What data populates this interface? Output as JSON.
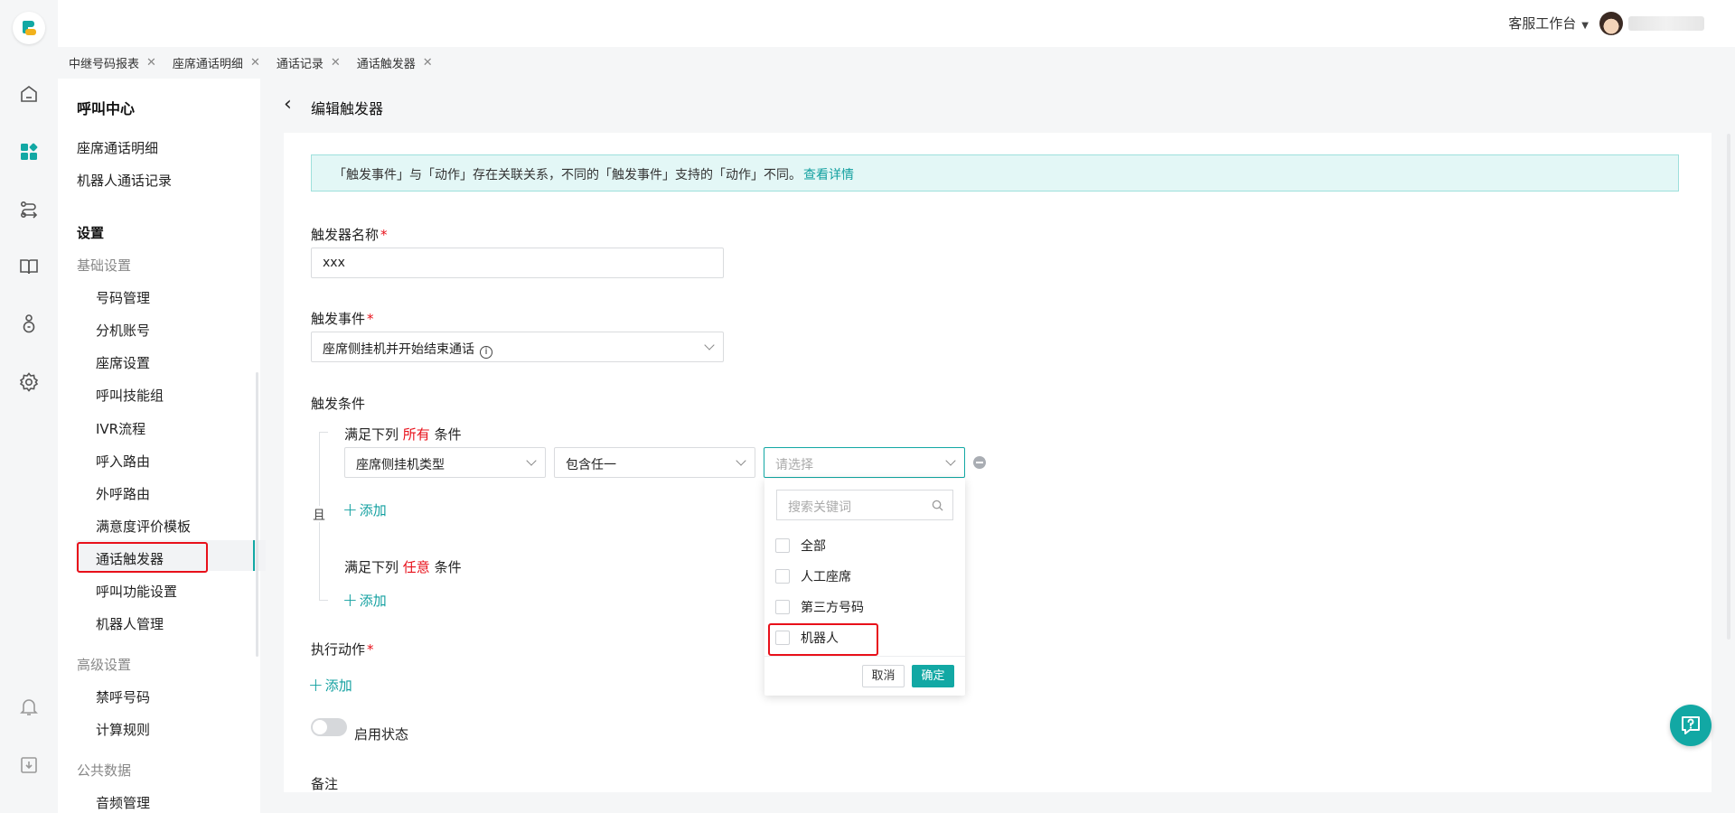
{
  "topbar": {
    "workspace_label": "客服工作台"
  },
  "tabs": [
    {
      "label": "中继号码报表"
    },
    {
      "label": "座席通话明细"
    },
    {
      "label": "通话记录"
    },
    {
      "label": "通话触发器"
    }
  ],
  "sidebar": {
    "title": "呼叫中心",
    "top_items": [
      "座席通话明细",
      "机器人通话记录"
    ],
    "settings_title": "设置",
    "groups": {
      "basic": "基础设置",
      "advanced": "高级设置",
      "public": "公共数据"
    },
    "basic_items": [
      "号码管理",
      "分机账号",
      "座席设置",
      "呼叫技能组",
      "IVR流程",
      "呼入路由",
      "外呼路由",
      "满意度评价模板",
      "通话触发器",
      "呼叫功能设置",
      "机器人管理"
    ],
    "advanced_items": [
      "禁呼号码",
      "计算规则"
    ],
    "public_items": [
      "音频管理"
    ],
    "active_item": "通话触发器"
  },
  "page": {
    "title": "编辑触发器",
    "notice_text": "「触发事件」与「动作」存在关联关系，不同的「触发事件」支持的「动作」不同。",
    "notice_link": "查看详情"
  },
  "form": {
    "name_label": "触发器名称",
    "name_value": "xxx",
    "event_label": "触发事件",
    "event_value": "座席侧挂机并开始结束通话",
    "conditions_label": "触发条件",
    "all_prefix": "满足下列",
    "all_keyword": "所有",
    "all_suffix": "条件",
    "any_prefix": "满足下列",
    "any_keyword": "任意",
    "any_suffix": "条件",
    "and_tag": "且",
    "cond_field": "座席侧挂机类型",
    "cond_operator": "包含任一",
    "cond_value_placeholder": "请选择",
    "add_label": "添加",
    "actions_label": "执行动作",
    "enable_label": "启用状态",
    "remark_label": "备注",
    "required_mark": "*"
  },
  "dropdown": {
    "search_placeholder": "搜索关键词",
    "options": [
      "全部",
      "人工座席",
      "第三方号码",
      "机器人"
    ],
    "cancel": "取消",
    "confirm": "确定"
  },
  "colors": {
    "accent": "#12a8a4",
    "highlight_red": "#e8101a"
  },
  "icons": [
    "home-icon",
    "apps-icon",
    "route-icon",
    "book-icon",
    "bag-icon",
    "gear-icon",
    "bell-icon",
    "download-icon",
    "help-icon",
    "search-icon"
  ]
}
